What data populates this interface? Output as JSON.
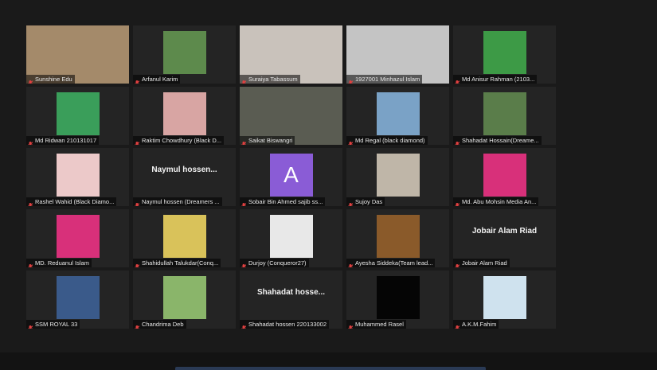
{
  "tiles": [
    {
      "name": "Sunshine Edu",
      "kind": "full",
      "bg": "#a48a6a"
    },
    {
      "name": "Arfanul Karim",
      "kind": "mid",
      "bg": "#5d8a4c"
    },
    {
      "name": "Suraiya Tabassum",
      "kind": "full",
      "bg": "#c9c2bb"
    },
    {
      "name": "1927001 Minhazul Islam",
      "kind": "full",
      "bg": "#c4c4c4"
    },
    {
      "name": "Md Anisur Rahman (2103...",
      "kind": "mid",
      "bg": "#3d9a46"
    },
    {
      "name": "Md Ridwan 210131017",
      "kind": "mid",
      "bg": "#3a9e5a"
    },
    {
      "name": "Raktim Chowdhury (Black D...",
      "kind": "mid",
      "bg": "#d8a5a3"
    },
    {
      "name": "Saikat Biswangri",
      "kind": "full",
      "bg": "#5a5c52",
      "active": true
    },
    {
      "name": "Md Regal (black diamond)",
      "kind": "mid",
      "bg": "#7aa2c6"
    },
    {
      "name": "Shahadat Hossain(Dreame...",
      "kind": "mid",
      "bg": "#5a7d4a"
    },
    {
      "name": "Rashel Wahid (Black Diamo...",
      "kind": "mid",
      "bg": "#ecc9c9"
    },
    {
      "name": "Naymul hossen (Dreamers ...",
      "kind": "text",
      "big": "Naymul hossen..."
    },
    {
      "name": "Sobair Bin Ahmed sajib ss...",
      "kind": "letter",
      "letter": "A"
    },
    {
      "name": "Sujoy Das",
      "kind": "mid",
      "bg": "#bfb6a8"
    },
    {
      "name": "Md. Abu Mohsin Media An...",
      "kind": "mid",
      "bg": "#d8307a"
    },
    {
      "name": "MD. Reduanul Islam",
      "kind": "mid",
      "bg": "#d8307a"
    },
    {
      "name": "Shahidullah Talukdar(Conq...",
      "kind": "mid",
      "bg": "#d9c25a"
    },
    {
      "name": "Durjoy (Conqueror27)",
      "kind": "mid",
      "bg": "#e8e8e8"
    },
    {
      "name": "Ayesha Siddeka(Team lead...",
      "kind": "mid",
      "bg": "#8a5a2a"
    },
    {
      "name": "Jobair Alam Riad",
      "kind": "text",
      "big": "Jobair Alam Riad"
    },
    {
      "name": "SSM ROYAL 33",
      "kind": "mid",
      "bg": "#3a5a8a"
    },
    {
      "name": "Chandrima Deb",
      "kind": "mid",
      "bg": "#8ab56a"
    },
    {
      "name": "Shahadat hossen 220133002",
      "kind": "text",
      "big": "Shahadat hosse..."
    },
    {
      "name": "Muhammed Rasel",
      "kind": "mid",
      "bg": "#050505"
    },
    {
      "name": "A.K.M.Fahim",
      "kind": "mid",
      "bg": "#cfe2ee"
    }
  ],
  "colors": {
    "mic_muted": "#e04040",
    "active_speaker": "#9ac84a"
  }
}
